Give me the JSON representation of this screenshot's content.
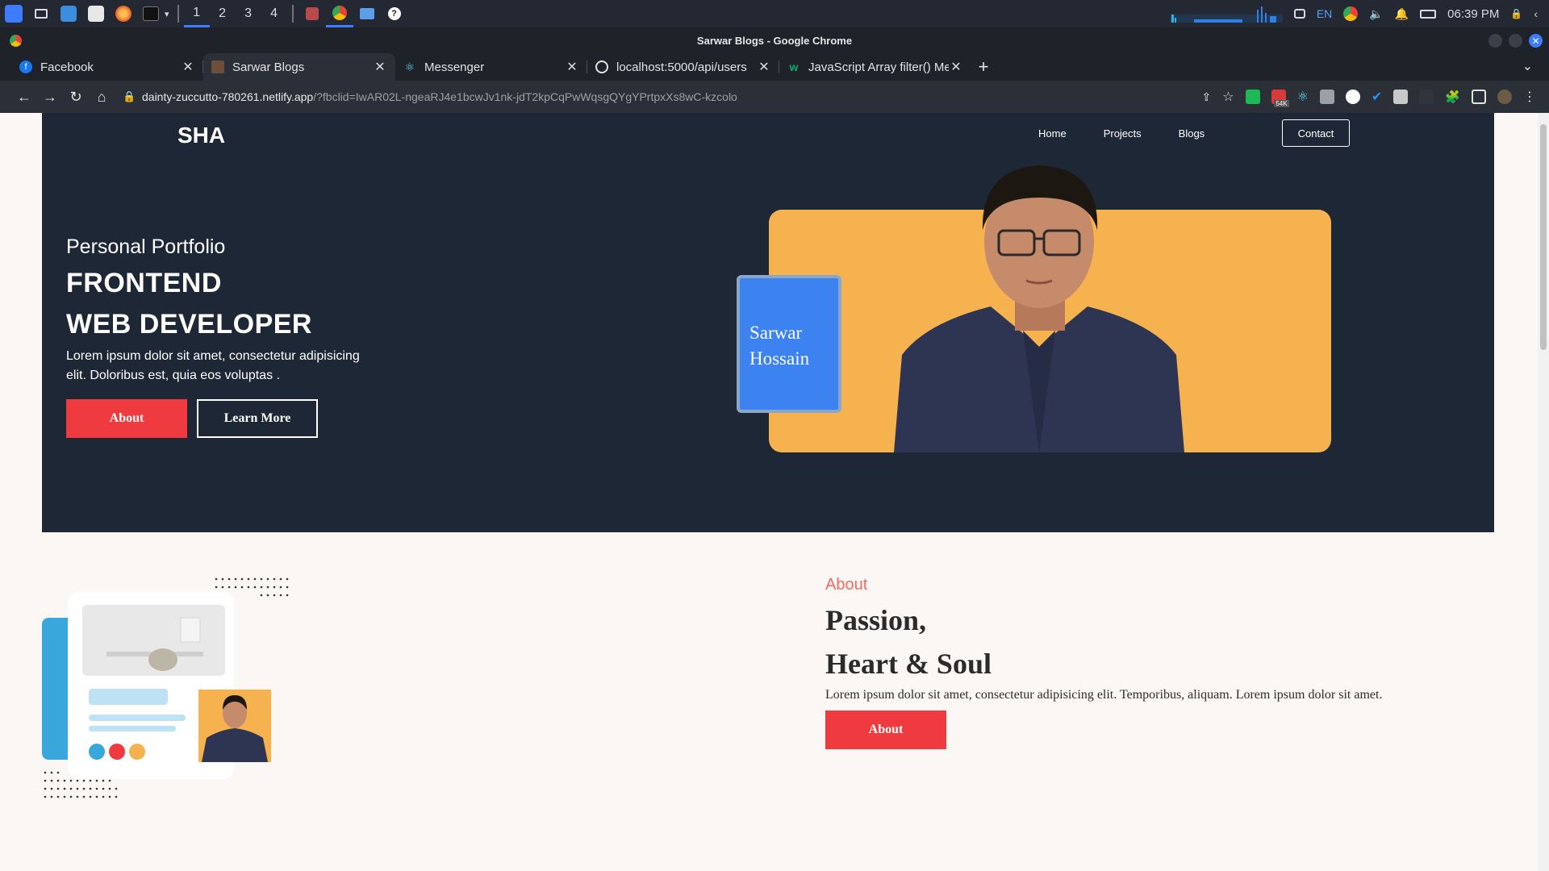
{
  "taskbar": {
    "workspaces": [
      "1",
      "2",
      "3",
      "4"
    ],
    "active_workspace": "1",
    "language": "EN",
    "clock": "06:39 PM"
  },
  "browser": {
    "window_title": "Sarwar Blogs - Google Chrome",
    "tabs": [
      {
        "title": "Facebook",
        "active": false,
        "favicon_color": "#1877f2"
      },
      {
        "title": "Sarwar Blogs",
        "active": true,
        "favicon_color": "#6b4f3a"
      },
      {
        "title": "Messenger",
        "active": false,
        "favicon_color": "#61dafb"
      },
      {
        "title": "localhost:5000/api/users",
        "active": false,
        "favicon_color": "#e3e3e3"
      },
      {
        "title": "JavaScript Array filter() Me",
        "active": false,
        "favicon_color": "#04aa6d"
      }
    ],
    "url_host": "dainty-zuccutto-780261.netlify.app",
    "url_path": "/?fbclid=IwAR02L-ngeaRJ4e1bcwJv1nk-jdT2kpCqPwWqsgQYgYPrtpxXs8wC-kzcolo",
    "extension_badge": "54K"
  },
  "site": {
    "logo": "SHA",
    "nav": [
      "Home",
      "Projects",
      "Blogs"
    ],
    "contact_label": "Contact",
    "hero": {
      "subtitle": "Personal Portfolio",
      "title_line1": "FRONTEND",
      "title_line2": "WEB DEVELOPER",
      "description": "Lorem ipsum dolor sit amet, consectetur adipisicing elit. Doloribus est, quia eos voluptas .",
      "primary_button": "About",
      "secondary_button": "Learn More",
      "name_line1": "Sarwar",
      "name_line2": "Hossain"
    },
    "about": {
      "label": "About",
      "heading_line1": "Passion,",
      "heading_line2": "Heart & Soul",
      "description": "Lorem ipsum dolor sit amet, consectetur adipisicing elit. Temporibus, aliquam. Lorem ipsum dolor sit amet.",
      "button": "About"
    }
  },
  "colors": {
    "hero_bg": "#1e2736",
    "accent_red": "#ef3b3f",
    "card_orange": "#f6b24e",
    "name_card_blue": "#3c82f0",
    "about_label": "#ef6b61"
  }
}
